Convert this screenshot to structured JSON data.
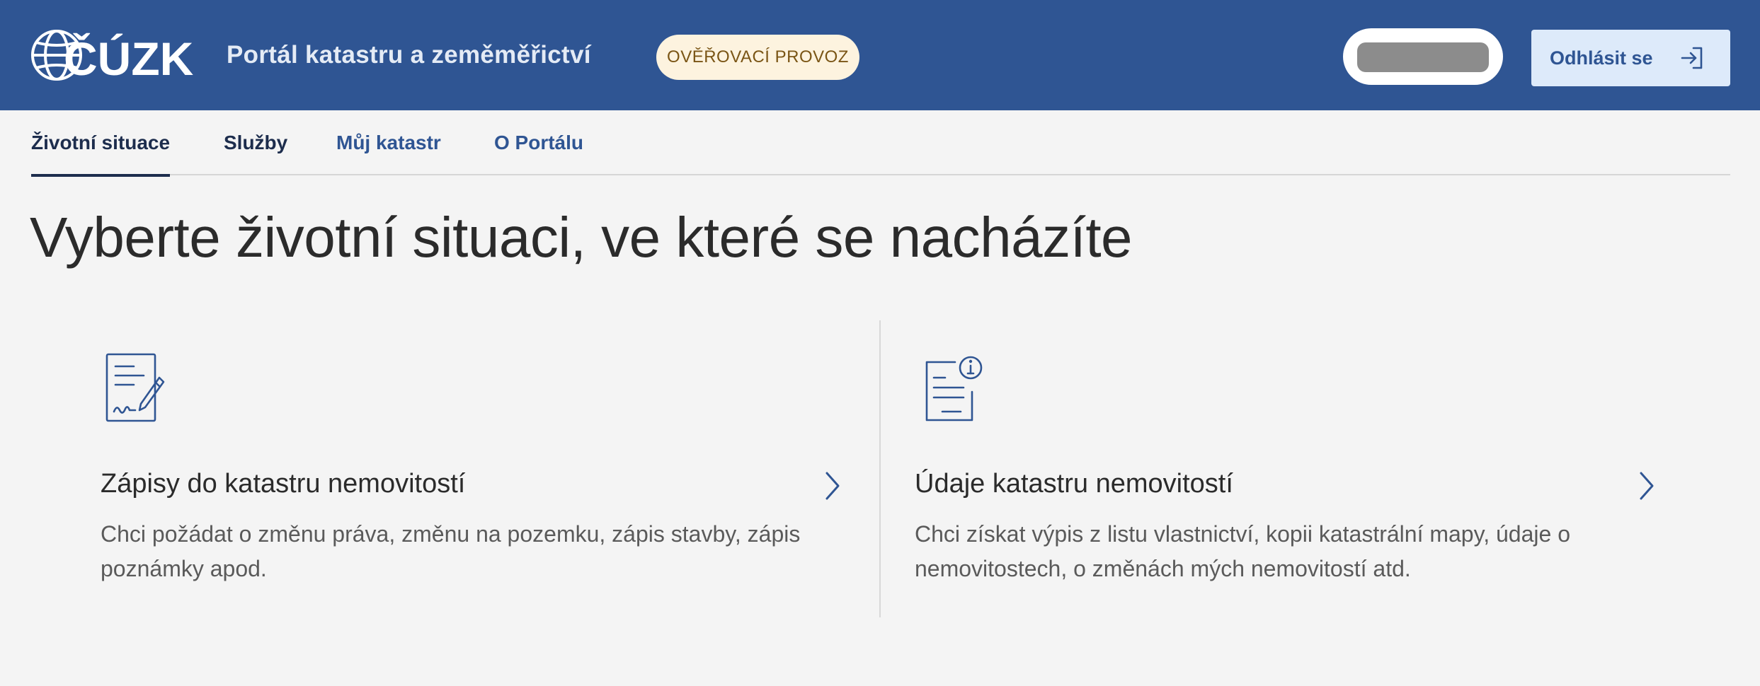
{
  "header": {
    "logo_text": "ČÚZK",
    "portal_title": "Portál katastru a zeměměřictví",
    "badge": "OVĚŘOVACÍ PROVOZ",
    "logout_label": "Odhlásit se"
  },
  "tabs": [
    {
      "label": "Životní situace",
      "active": true
    },
    {
      "label": "Služby",
      "active": false
    },
    {
      "label": "Můj katastr",
      "active": false
    },
    {
      "label": "O Portálu",
      "active": false
    }
  ],
  "page_heading": "Vyberte životní situaci, ve které se nacházíte",
  "cards": [
    {
      "icon": "document-sign-icon",
      "title": "Zápisy do katastru nemovitostí",
      "desc_line1": "Chci požádat o změnu práva, změnu na pozemku, zápis stavby, zápis",
      "desc_line2": "poznámky apod."
    },
    {
      "icon": "document-info-icon",
      "title": "Údaje katastru nemovitostí",
      "desc_line1": "Chci získat výpis z listu vlastnictví, kopii katastrální mapy, údaje o",
      "desc_line2": "nemovitostech, o změnách mých nemovitostí atd."
    }
  ],
  "colors": {
    "header_bg": "#2f5593",
    "badge_bg": "#fdf3df",
    "logout_bg": "#ddeafa",
    "page_bg": "#f4f4f4",
    "accent_dark": "#1d2d4d"
  }
}
